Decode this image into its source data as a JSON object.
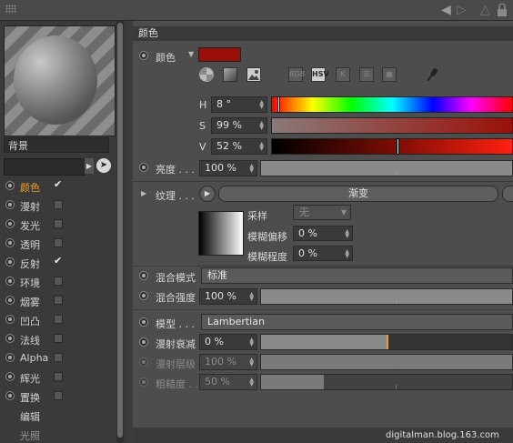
{
  "left": {
    "object_name": "背景",
    "channels": [
      {
        "label": "颜色",
        "checked": true,
        "active": true
      },
      {
        "label": "漫射",
        "checked": false
      },
      {
        "label": "发光",
        "checked": false
      },
      {
        "label": "透明",
        "checked": false
      },
      {
        "label": "反射",
        "checked": true
      },
      {
        "label": "环境",
        "checked": false
      },
      {
        "label": "烟雾",
        "checked": false
      },
      {
        "label": "凹凸",
        "checked": false
      },
      {
        "label": "法线",
        "checked": false
      },
      {
        "label": "Alpha",
        "checked": false
      },
      {
        "label": "辉光",
        "checked": false
      },
      {
        "label": "置换",
        "checked": false
      }
    ],
    "edit_label": "编辑",
    "illum_label": "光照"
  },
  "section_title": "颜色",
  "color": {
    "label": "颜色",
    "swatch": "#9a1008",
    "modes": [
      "RGB",
      "HSV",
      "K"
    ],
    "H_label": "H",
    "H_value": "8 °",
    "H_fraction": 0.022,
    "S_label": "S",
    "S_value": "99 %",
    "S_fraction": 0.99,
    "V_label": "V",
    "V_value": "52 %",
    "V_fraction": 0.52
  },
  "brightness": {
    "label": "亮度 . . .",
    "value": "100 %",
    "fraction": 1.0
  },
  "texture": {
    "label": "纹理 . . .",
    "button": "渐变"
  },
  "texture_opts": {
    "sampling_label": "采样",
    "sampling_value": "无",
    "blur_offset_label": "模糊偏移",
    "blur_offset_value": "0 %",
    "blur_degree_label": "模糊程度",
    "blur_degree_value": "0 %"
  },
  "mix_mode": {
    "label": "混合模式",
    "value": "标准"
  },
  "mix_strength": {
    "label": "混合强度",
    "value": "100 %",
    "fraction": 1.0
  },
  "model": {
    "label": "模型 . . .",
    "value": "Lambertian"
  },
  "diffuse_falloff": {
    "label": "漫射衰减",
    "value": "0 %",
    "fraction": 0.5
  },
  "diffuse_level": {
    "label": "漫射层级",
    "value": "100 %"
  },
  "roughness": {
    "label": "粗糙度 . .",
    "value": "50 %",
    "fraction": 0.25
  },
  "footer": "digitalman.blog.163.com",
  "icons": [
    "back-arrow-icon",
    "forward-arrow-icon",
    "up-arrow-icon",
    "lock-icon",
    "eyedropper-icon"
  ]
}
